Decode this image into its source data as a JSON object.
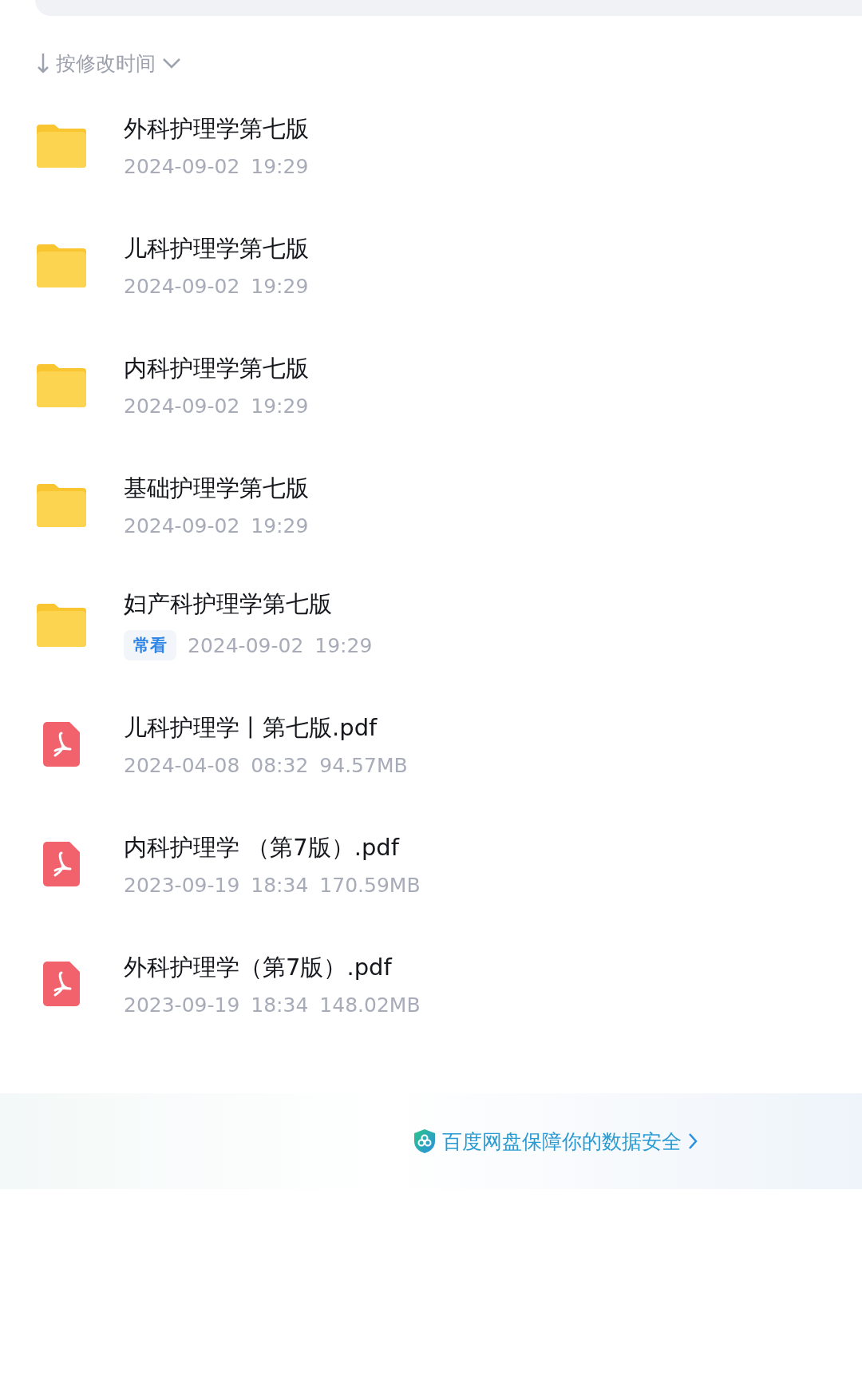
{
  "sort": {
    "label": "按修改时间"
  },
  "files": [
    {
      "kind": "folder",
      "name": "外科护理学第七版",
      "date": "2024-09-02",
      "time": "19:29"
    },
    {
      "kind": "folder",
      "name": "儿科护理学第七版",
      "date": "2024-09-02",
      "time": "19:29"
    },
    {
      "kind": "folder",
      "name": "内科护理学第七版",
      "date": "2024-09-02",
      "time": "19:29"
    },
    {
      "kind": "folder",
      "name": "基础护理学第七版",
      "date": "2024-09-02",
      "time": "19:29"
    },
    {
      "kind": "folder",
      "name": "妇产科护理学第七版",
      "tag": "常看",
      "date": "2024-09-02",
      "time": "19:29"
    },
    {
      "kind": "pdf",
      "name": "儿科护理学丨第七版.pdf",
      "date": "2024-04-08",
      "time": "08:32",
      "size": "94.57MB"
    },
    {
      "kind": "pdf",
      "name": "内科护理学 （第7版）.pdf",
      "date": "2023-09-19",
      "time": "18:34",
      "size": "170.59MB"
    },
    {
      "kind": "pdf",
      "name": "外科护理学（第7版）.pdf",
      "date": "2023-09-19",
      "time": "18:34",
      "size": "148.02MB"
    }
  ],
  "footer": {
    "text": "百度网盘保障你的数据安全"
  }
}
